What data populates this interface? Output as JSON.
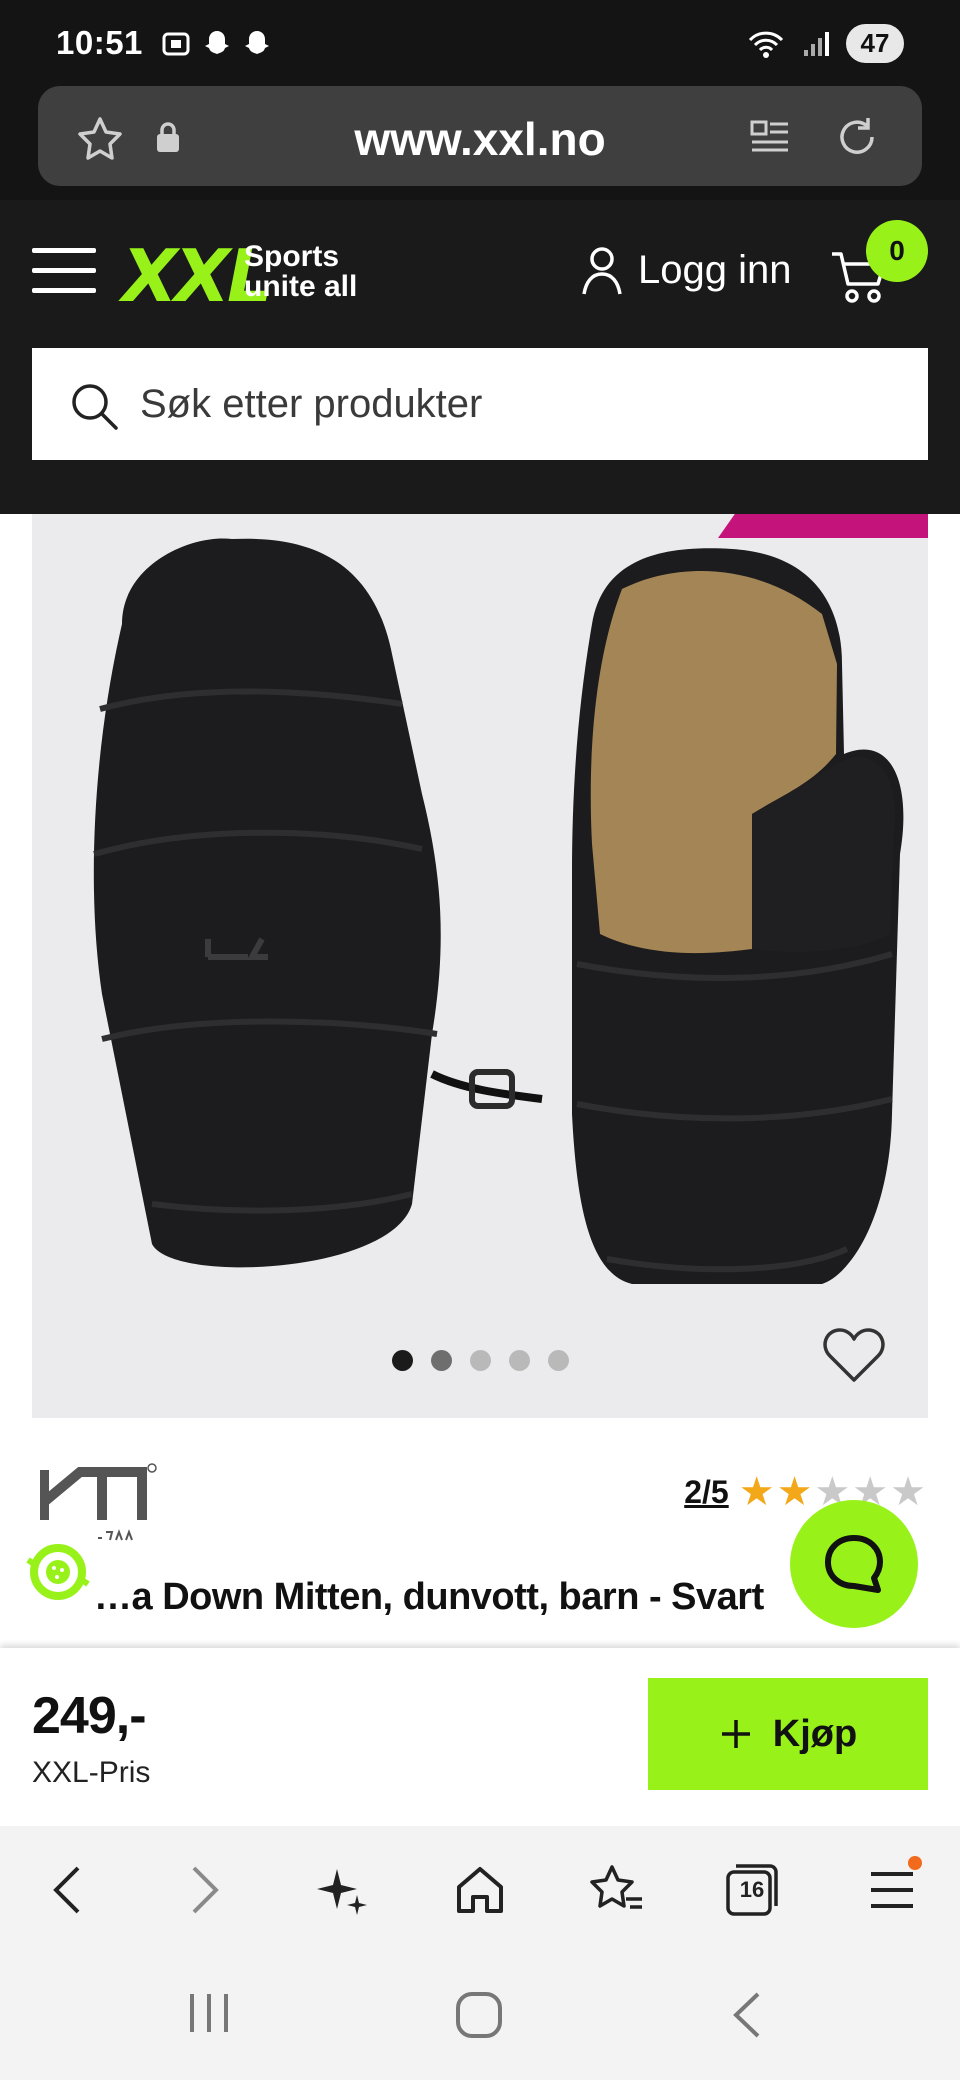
{
  "status_bar": {
    "time": "10:51",
    "battery": "47"
  },
  "browser": {
    "url": "www.xxl.no",
    "tab_count": "16"
  },
  "header": {
    "logo": "XXL",
    "tagline_line1": "Sports",
    "tagline_line2": "unite all",
    "login_label": "Logg inn",
    "cart_count": "0",
    "search_placeholder": "Søk etter produkter"
  },
  "product": {
    "image_dots": 5,
    "active_dot": 0,
    "rating_text": "2/5",
    "rating_value": 2,
    "rating_max": 5,
    "title": "…a Down Mitten, dunvott, barn - Svart",
    "price": "249,-",
    "price_label": "XXL-Pris",
    "buy_label": "Kjøp"
  },
  "colors": {
    "brand_green": "#98f21a",
    "header_bg": "#1a1a1a",
    "accent_pink": "#c4137a",
    "star": "#f3a81a"
  },
  "icons": [
    "star-outline-icon",
    "lock-icon",
    "reader-mode-icon",
    "reload-icon",
    "menu-icon",
    "user-icon",
    "cart-icon",
    "search-icon",
    "heart-icon",
    "chat-icon",
    "back-icon",
    "forward-icon",
    "sparkle-icon",
    "home-icon",
    "bookmark-star-icon",
    "tabs-icon"
  ]
}
